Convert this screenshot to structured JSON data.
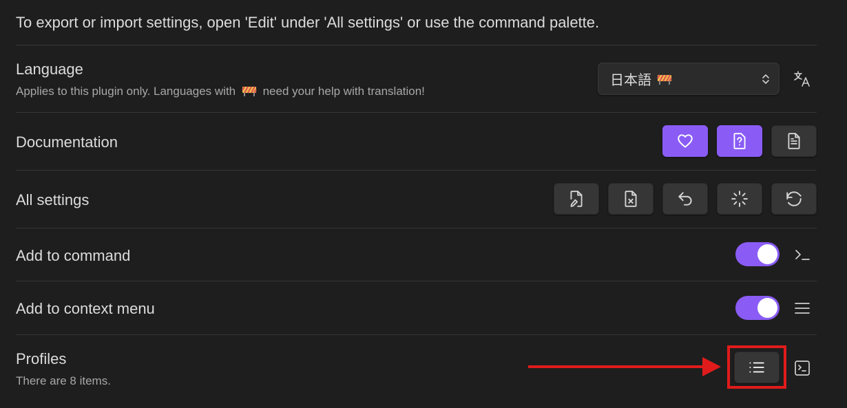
{
  "intro": "To export or import settings, open 'Edit' under 'All settings' or use the command palette.",
  "language": {
    "title": "Language",
    "description_before": "Applies to this plugin only. Languages with",
    "description_after": "need your help with translation!",
    "selected": "日本語",
    "badge_icon": "construction-barrier-icon",
    "side_icon": "translate-icon"
  },
  "documentation": {
    "title": "Documentation",
    "buttons": [
      "heart-icon",
      "help-file-icon",
      "document-icon"
    ]
  },
  "all_settings": {
    "title": "All settings",
    "buttons": [
      "edit-file-icon",
      "delete-file-icon",
      "undo-icon",
      "loader-icon",
      "rotate-ccw-icon"
    ]
  },
  "add_to_command": {
    "title": "Add to command",
    "enabled": true,
    "side_icon": "terminal-icon"
  },
  "add_to_context_menu": {
    "title": "Add to context menu",
    "enabled": true,
    "side_icon": "menu-icon"
  },
  "profiles": {
    "title": "Profiles",
    "description": "There are 8 items.",
    "button_icon": "list-icon",
    "side_icon": "terminal-square-icon"
  },
  "colors": {
    "accent": "#8a5cf5",
    "highlight": "#e01b1b",
    "background": "#1e1e1e"
  }
}
